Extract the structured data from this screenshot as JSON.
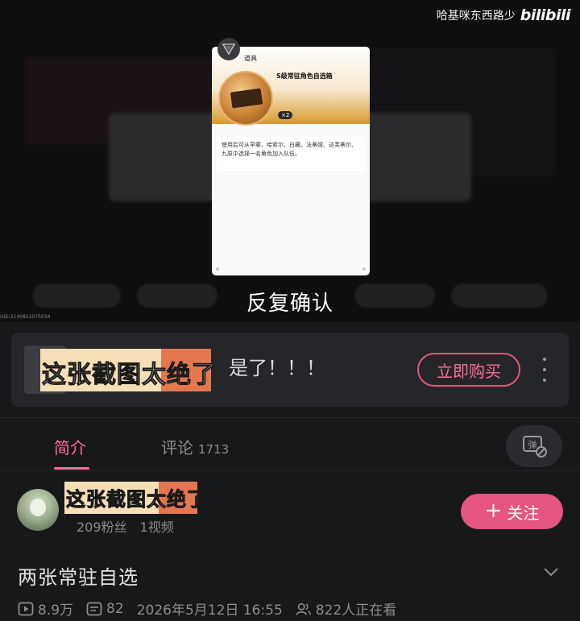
{
  "watermark": {
    "channel": "哈基咪东西路少",
    "logo": "bilibili"
  },
  "uid_tag": "UID:2140812075034",
  "item_card": {
    "header": "道具",
    "name": "S级常驻角色自选箱",
    "count": "×2",
    "description": "使用后可从早雾、哈索尔、白藏、法蒂娅、达芙蒂尔、九原中选择一名角色加入队伍。"
  },
  "video_caption": "反复确认",
  "banner": {
    "title_fragment": "是了！！！",
    "buy_button": "立即购买"
  },
  "overlay_sticker": "这张截图太绝了",
  "tabs": [
    {
      "label": "简介",
      "active": true
    },
    {
      "label": "评论",
      "count": "1713",
      "active": false
    }
  ],
  "uploader": {
    "followers": "209粉丝",
    "videos": "1视频",
    "follow_button": "关注"
  },
  "video": {
    "title": "两张常驻自选",
    "views": "8.9万",
    "danmaku": "82",
    "publish_time": "2026年5月12日 16:55",
    "watching": "822人正在看"
  },
  "colors": {
    "accent_pink": "#ff6d95",
    "follow_bg": "#e5557f",
    "background": "#17181a"
  }
}
